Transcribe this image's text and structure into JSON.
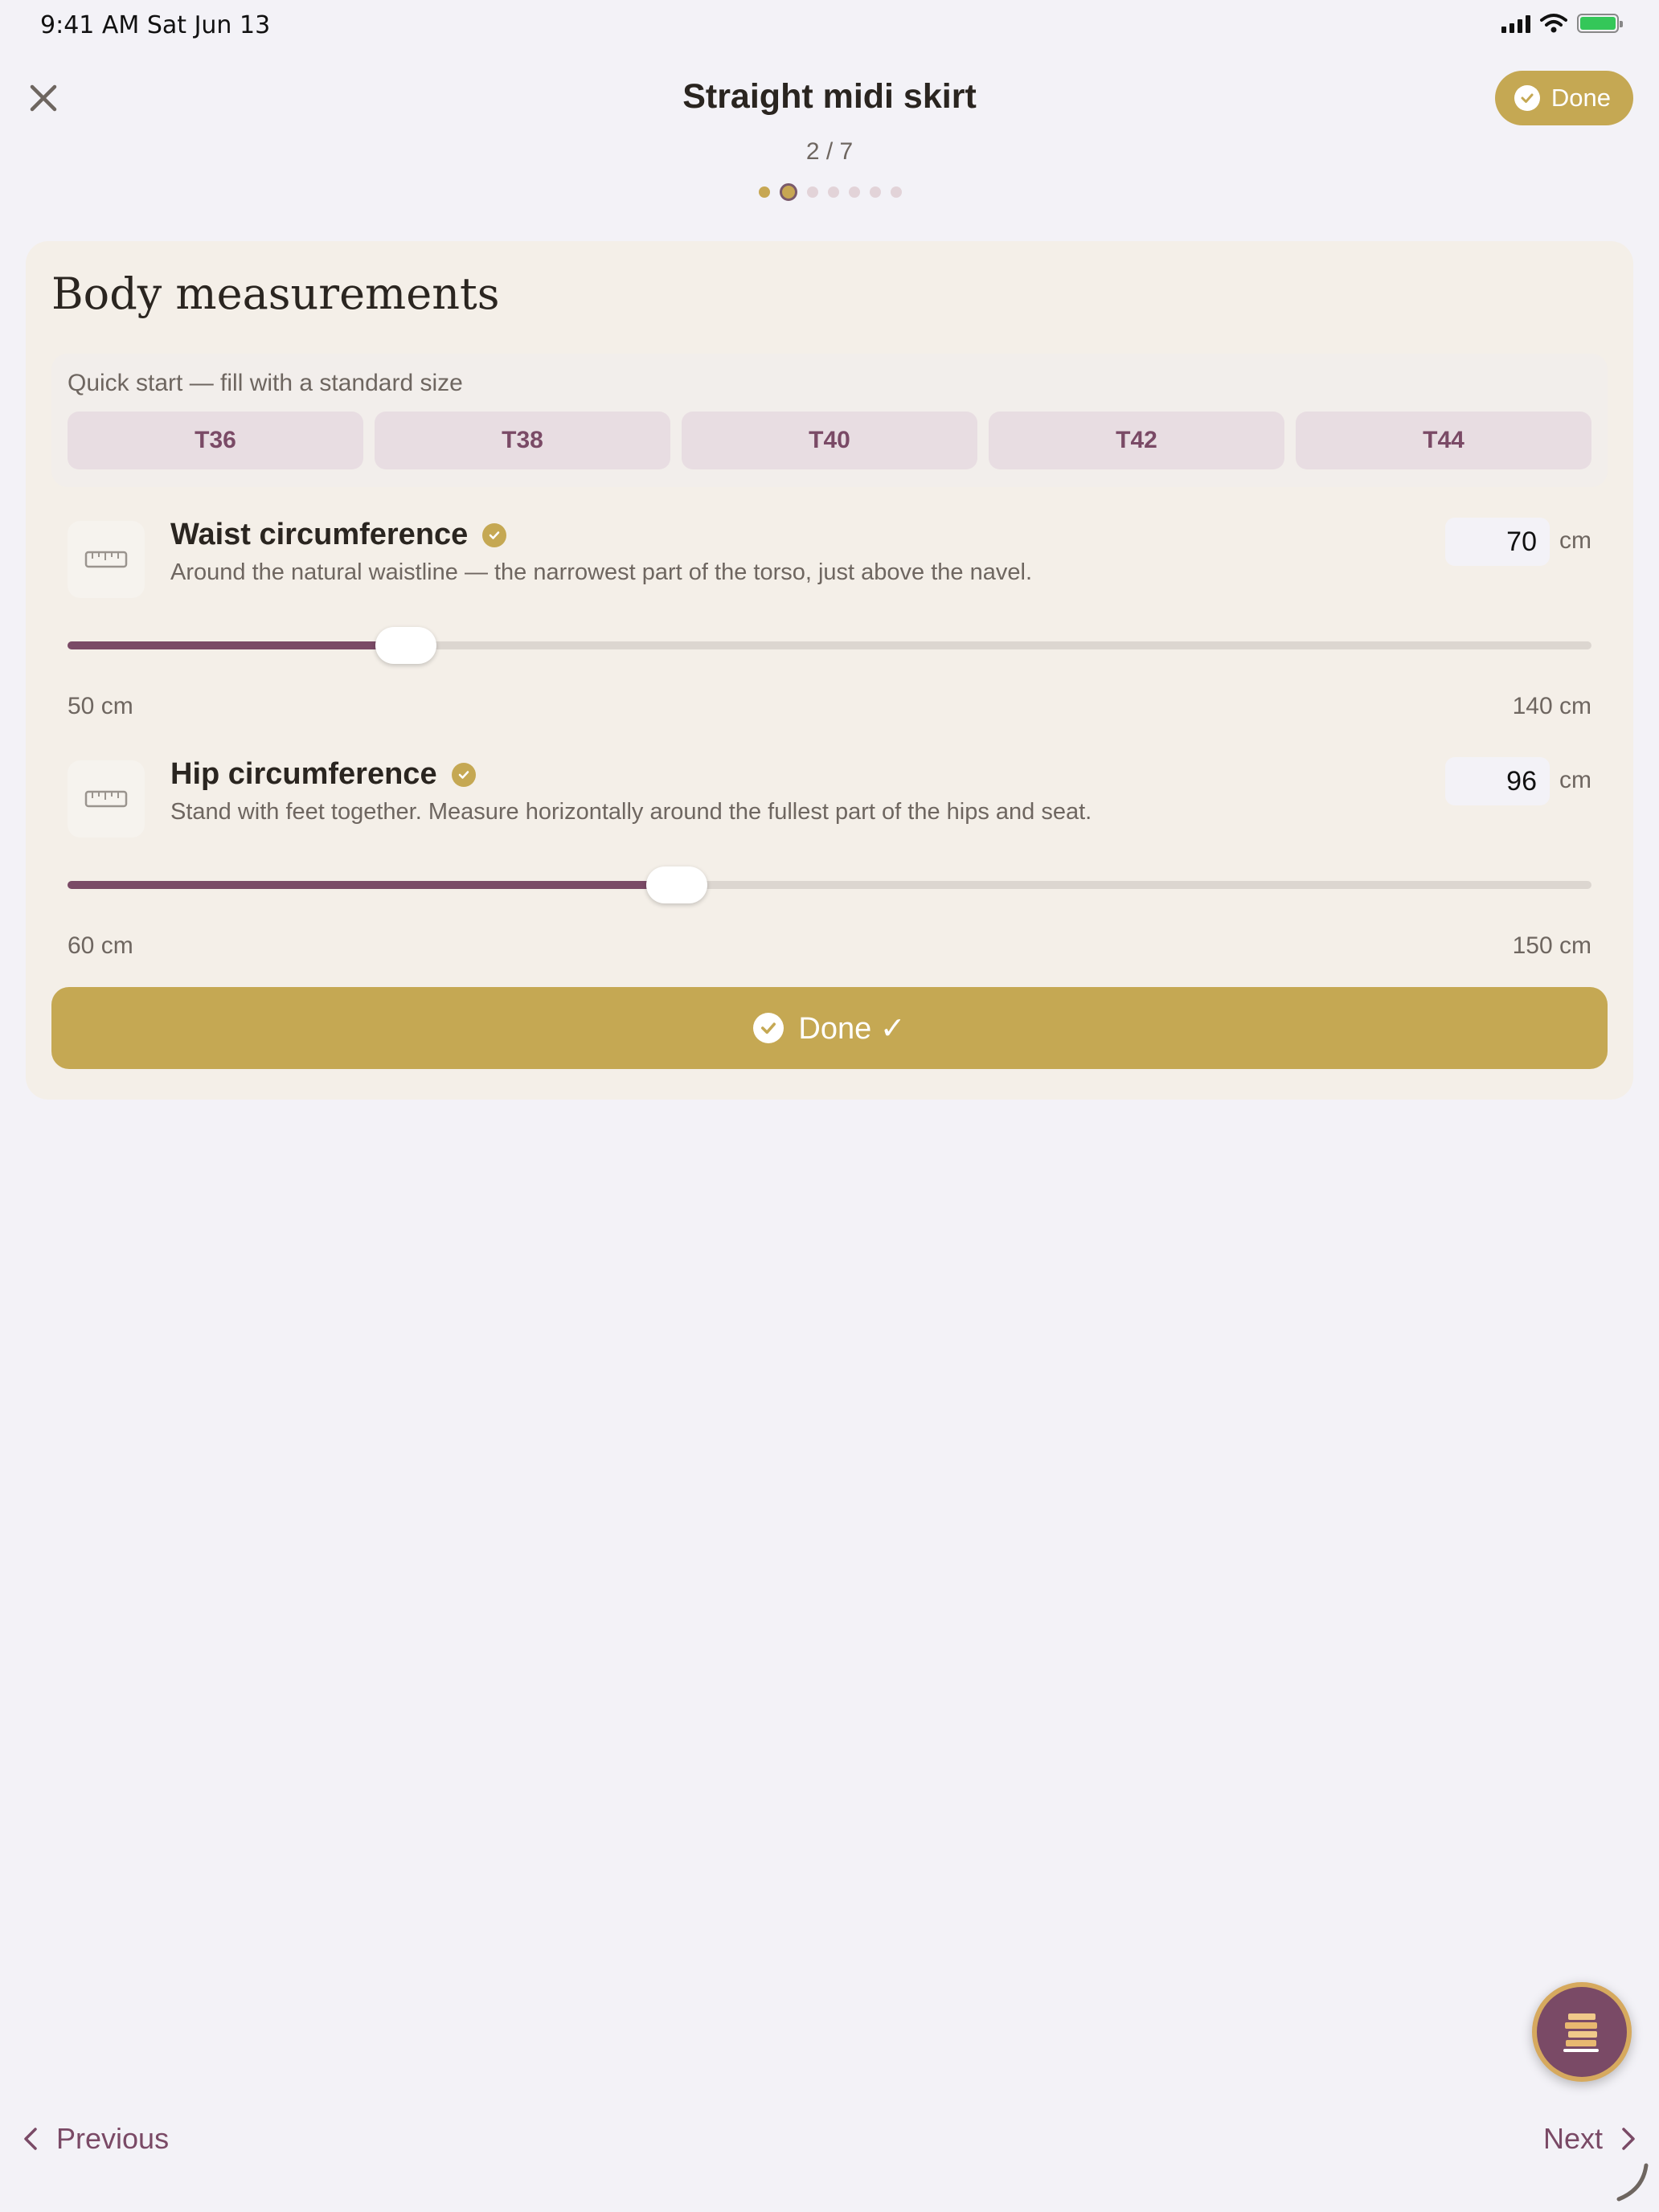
{
  "status_bar": {
    "time": "9:41 AM   Sat Jun 13"
  },
  "header": {
    "title": "Straight midi skirt",
    "step": "2 / 7",
    "done_label": "Done",
    "steps_total": 7,
    "current_step": 2
  },
  "card": {
    "title": "Body measurements",
    "quick_start": {
      "label": "Quick start — fill with a standard size",
      "sizes": [
        "T36",
        "T38",
        "T40",
        "T42",
        "T44"
      ]
    },
    "waist": {
      "title": "Waist circumference",
      "description": "Around the natural waistline — the narrowest part of the torso, just above the navel.",
      "value": "70",
      "unit": "cm",
      "min": 50,
      "max": 140,
      "min_label": "50 cm",
      "max_label": "140 cm"
    },
    "hip": {
      "title": "Hip circumference",
      "description": "Stand with feet together. Measure horizontally around the fullest part of the hips and seat.",
      "value": "96",
      "unit": "cm",
      "min": 60,
      "max": 150,
      "min_label": "60 cm",
      "max_label": "150 cm"
    },
    "done_button_label": "Done ✓"
  },
  "footer": {
    "previous_label": "Previous",
    "next_label": "Next"
  },
  "colors": {
    "accent_gold": "#c5a853",
    "accent_plum": "#7a4a66",
    "card_bg": "#f4efe8",
    "page_bg": "#f3f2f7"
  },
  "icons": [
    "close-icon",
    "check-icon",
    "ruler-icon",
    "book-stack-icon",
    "chevron-left-icon",
    "chevron-right-icon"
  ]
}
